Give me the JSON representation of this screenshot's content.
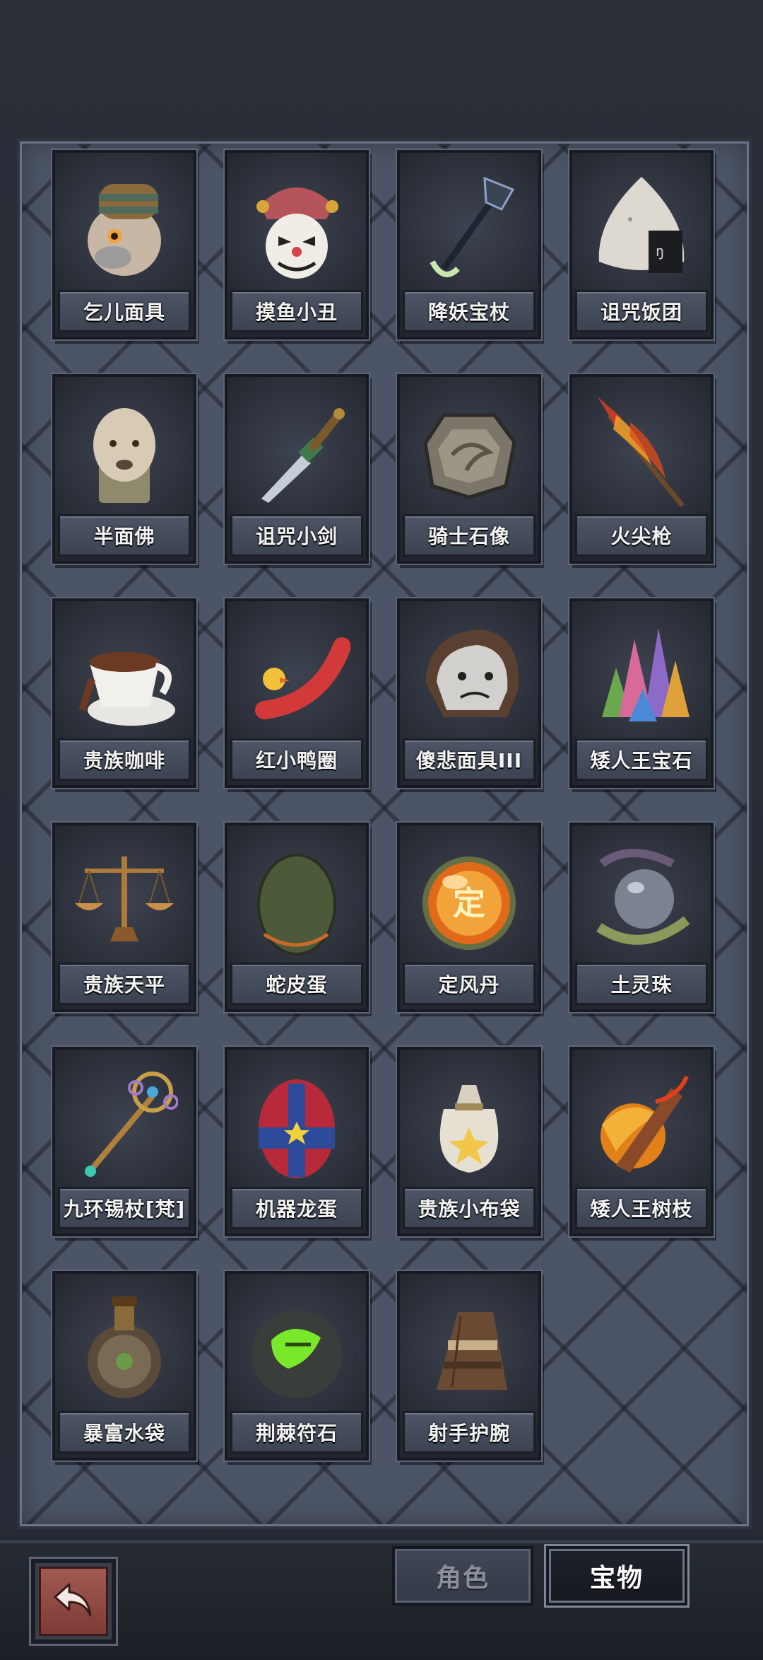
{
  "inventory": {
    "items": [
      {
        "label": "乞儿面具",
        "icon": "beggar-mask-icon"
      },
      {
        "label": "摸鱼小丑",
        "icon": "jester-mask-icon"
      },
      {
        "label": "降妖宝杖",
        "icon": "monk-staff-icon"
      },
      {
        "label": "诅咒饭团",
        "icon": "rice-ball-icon"
      },
      {
        "label": "半面佛",
        "icon": "buddha-head-icon"
      },
      {
        "label": "诅咒小剑",
        "icon": "dagger-icon"
      },
      {
        "label": "骑士石像",
        "icon": "stone-tablet-icon"
      },
      {
        "label": "火尖枪",
        "icon": "fire-spear-icon"
      },
      {
        "label": "贵族咖啡",
        "icon": "coffee-cup-icon"
      },
      {
        "label": "红小鸭圈",
        "icon": "duck-swim-ring-icon"
      },
      {
        "label": "傻悲面具III",
        "icon": "sad-helmet-icon"
      },
      {
        "label": "矮人王宝石",
        "icon": "crystal-cluster-icon"
      },
      {
        "label": "贵族天平",
        "icon": "balance-scale-icon"
      },
      {
        "label": "蛇皮蛋",
        "icon": "snake-egg-icon"
      },
      {
        "label": "定风丹",
        "icon": "wind-pill-orb-icon",
        "glyph": "定"
      },
      {
        "label": "土灵珠",
        "icon": "earth-orb-icon"
      },
      {
        "label": "九环锡杖[梵]",
        "icon": "nine-ring-staff-icon"
      },
      {
        "label": "机器龙蛋",
        "icon": "mech-dragon-egg-icon"
      },
      {
        "label": "贵族小布袋",
        "icon": "cloth-bag-icon"
      },
      {
        "label": "矮人王树枝",
        "icon": "burning-branch-icon"
      },
      {
        "label": "暴富水袋",
        "icon": "water-flask-icon"
      },
      {
        "label": "荆棘符石",
        "icon": "thorn-rune-stone-icon"
      },
      {
        "label": "射手护腕",
        "icon": "archer-bracer-icon"
      }
    ]
  },
  "tabs": {
    "role_label": "角色",
    "treasure_label": "宝物",
    "active": "treasure"
  },
  "colors": {
    "panel": "#4c5567",
    "card": "#23262e",
    "back_button": "#8e4a44",
    "active_tab": "#15181e"
  }
}
